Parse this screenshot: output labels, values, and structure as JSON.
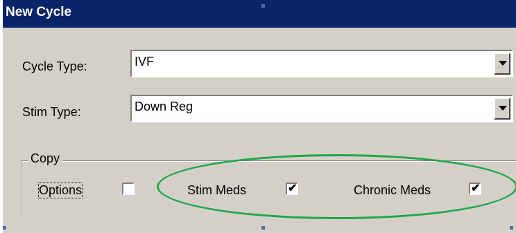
{
  "window": {
    "title": "New Cycle"
  },
  "fields": {
    "cycle_type": {
      "label": "Cycle Type:",
      "value": "IVF"
    },
    "stim_type": {
      "label": "Stim Type:",
      "value": "Down Reg"
    }
  },
  "copy_group": {
    "legend": "Copy",
    "options": {
      "label": "Options",
      "checked": false
    },
    "stim_meds": {
      "label": "Stim Meds",
      "checked": true
    },
    "chronic_meds": {
      "label": "Chronic Meds",
      "checked": true
    }
  },
  "colors": {
    "titlebar": "#0a246a",
    "dialog": "#d4d0c8",
    "highlight": "#1da64a"
  }
}
